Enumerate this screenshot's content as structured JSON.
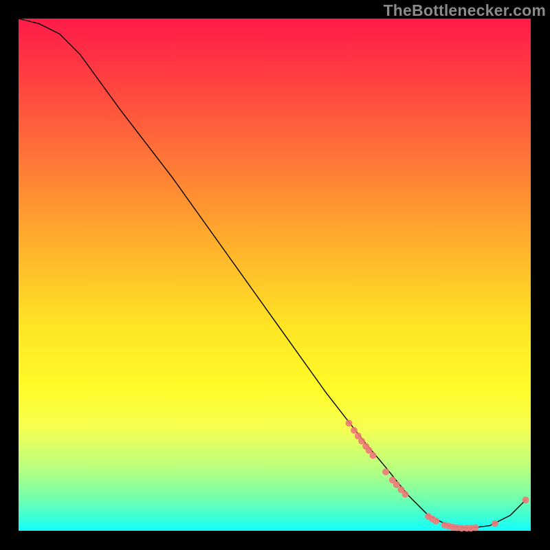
{
  "watermark": "TheBottlenecker.com",
  "chart_data": {
    "type": "line",
    "title": "",
    "xlabel": "",
    "ylabel": "",
    "xlim": [
      0,
      100
    ],
    "ylim": [
      0,
      100
    ],
    "grid": false,
    "curve": [
      {
        "x": 0,
        "y": 100
      },
      {
        "x": 4,
        "y": 99
      },
      {
        "x": 8,
        "y": 97
      },
      {
        "x": 12,
        "y": 93
      },
      {
        "x": 20,
        "y": 82
      },
      {
        "x": 30,
        "y": 69
      },
      {
        "x": 40,
        "y": 55
      },
      {
        "x": 50,
        "y": 41
      },
      {
        "x": 60,
        "y": 27
      },
      {
        "x": 67,
        "y": 18
      },
      {
        "x": 72,
        "y": 12
      },
      {
        "x": 76,
        "y": 7
      },
      {
        "x": 80,
        "y": 3
      },
      {
        "x": 84,
        "y": 1
      },
      {
        "x": 88,
        "y": 0.5
      },
      {
        "x": 92,
        "y": 1
      },
      {
        "x": 96,
        "y": 3
      },
      {
        "x": 99,
        "y": 6
      }
    ],
    "points": [
      {
        "x": 64.5,
        "y": 21.0
      },
      {
        "x": 65.5,
        "y": 19.6
      },
      {
        "x": 66.3,
        "y": 18.5
      },
      {
        "x": 67.0,
        "y": 17.5
      },
      {
        "x": 67.8,
        "y": 16.5
      },
      {
        "x": 68.4,
        "y": 15.7
      },
      {
        "x": 69.2,
        "y": 14.7
      },
      {
        "x": 71.7,
        "y": 11.5
      },
      {
        "x": 73.0,
        "y": 9.9
      },
      {
        "x": 73.8,
        "y": 9.0
      },
      {
        "x": 74.7,
        "y": 8.0
      },
      {
        "x": 75.5,
        "y": 7.1
      },
      {
        "x": 80.0,
        "y": 2.8
      },
      {
        "x": 80.8,
        "y": 2.3
      },
      {
        "x": 81.5,
        "y": 1.9
      },
      {
        "x": 83.2,
        "y": 1.1
      },
      {
        "x": 84.0,
        "y": 0.9
      },
      {
        "x": 84.8,
        "y": 0.7
      },
      {
        "x": 85.6,
        "y": 0.6
      },
      {
        "x": 86.5,
        "y": 0.5
      },
      {
        "x": 87.5,
        "y": 0.5
      },
      {
        "x": 88.3,
        "y": 0.5
      },
      {
        "x": 89.2,
        "y": 0.6
      },
      {
        "x": 93.0,
        "y": 1.4
      },
      {
        "x": 99.0,
        "y": 6.0
      }
    ],
    "colors": {
      "curve": "#000000",
      "points": "#f07878",
      "gradient_top": "#ff1b4a",
      "gradient_bottom": "#10ffff"
    }
  }
}
